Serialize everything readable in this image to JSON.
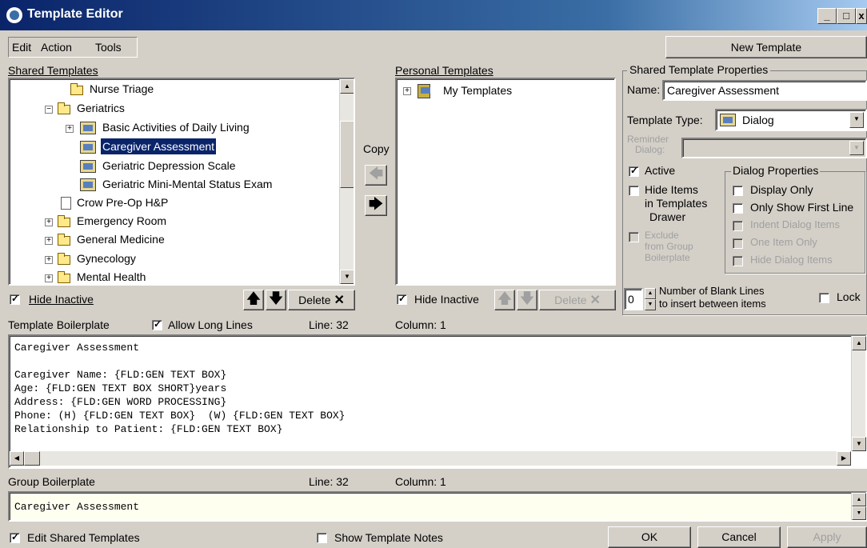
{
  "window": {
    "title": "Template Editor",
    "min": "_",
    "max": "□",
    "close": "x"
  },
  "menu": {
    "edit": "Edit",
    "action": "Action",
    "tools": "Tools"
  },
  "new_template_button": "New Template",
  "shared_templates": {
    "label": "Shared Templates",
    "items": [
      {
        "label": "Nurse Triage",
        "type": "folder"
      },
      {
        "label": "Geriatrics",
        "type": "open-folder"
      },
      {
        "label": "Basic Activities of Daily Living",
        "type": "dialog"
      },
      {
        "label": "Caregiver Assessment",
        "type": "dialog",
        "selected": true
      },
      {
        "label": "Geriatric Depression Scale",
        "type": "dialog"
      },
      {
        "label": "Geriatric Mini-Mental Status Exam",
        "type": "dialog"
      },
      {
        "label": "Crow Pre-Op H&P",
        "type": "doc"
      },
      {
        "label": "Emergency Room",
        "type": "folder"
      },
      {
        "label": "General Medicine",
        "type": "folder"
      },
      {
        "label": "Gynecology",
        "type": "folder"
      },
      {
        "label": "Mental Health",
        "type": "folder"
      }
    ],
    "hide_inactive": "Hide Inactive",
    "delete": "Delete"
  },
  "copy_label": "Copy",
  "personal_templates": {
    "label": "Personal Templates",
    "items": [
      {
        "label": "My Templates"
      }
    ],
    "hide_inactive": "Hide Inactive",
    "delete": "Delete"
  },
  "properties": {
    "group_label": "Shared Template Properties",
    "name_label": "Name:",
    "name_value": "Caregiver Assessment",
    "type_label": "Template Type:",
    "type_value": "Dialog",
    "reminder_label_1": "Reminder",
    "reminder_label_2": "Dialog:",
    "active": "Active",
    "hide_items_1": "Hide Items",
    "hide_items_2": "in Templates",
    "hide_items_3": "Drawer",
    "exclude_1": "Exclude",
    "exclude_2": "from Group",
    "exclude_3": "Boilerplate",
    "dialog_props_label": "Dialog Properties",
    "display_only": "Display Only",
    "only_first_line": "Only Show First Line",
    "indent_items": "Indent Dialog Items",
    "one_item_only": "One Item Only",
    "hide_dialog_items": "Hide Dialog Items",
    "blank_lines_value": "0",
    "blank_lines_1": "Number of Blank Lines",
    "blank_lines_2": "to insert between items",
    "lock": "Lock"
  },
  "boilerplate": {
    "label": "Template Boilerplate",
    "allow_long_lines": "Allow Long Lines",
    "line": "Line: 32",
    "column": "Column: 1",
    "lines": [
      "Caregiver Assessment",
      "",
      "Caregiver Name: {FLD:GEN TEXT BOX}",
      "Age: {FLD:GEN TEXT BOX SHORT}years",
      "Address: {FLD:GEN WORD PROCESSING}",
      "Phone: (H) {FLD:GEN TEXT BOX}  (W) {FLD:GEN TEXT BOX}",
      "Relationship to Patient: {FLD:GEN TEXT BOX}"
    ]
  },
  "group_boilerplate": {
    "label": "Group Boilerplate",
    "line": "Line: 32",
    "column": "Column: 1",
    "text": "Caregiver Assessment"
  },
  "footer": {
    "edit_shared": "Edit Shared Templates",
    "show_notes": "Show Template Notes",
    "ok": "OK",
    "cancel": "Cancel",
    "apply": "Apply"
  }
}
